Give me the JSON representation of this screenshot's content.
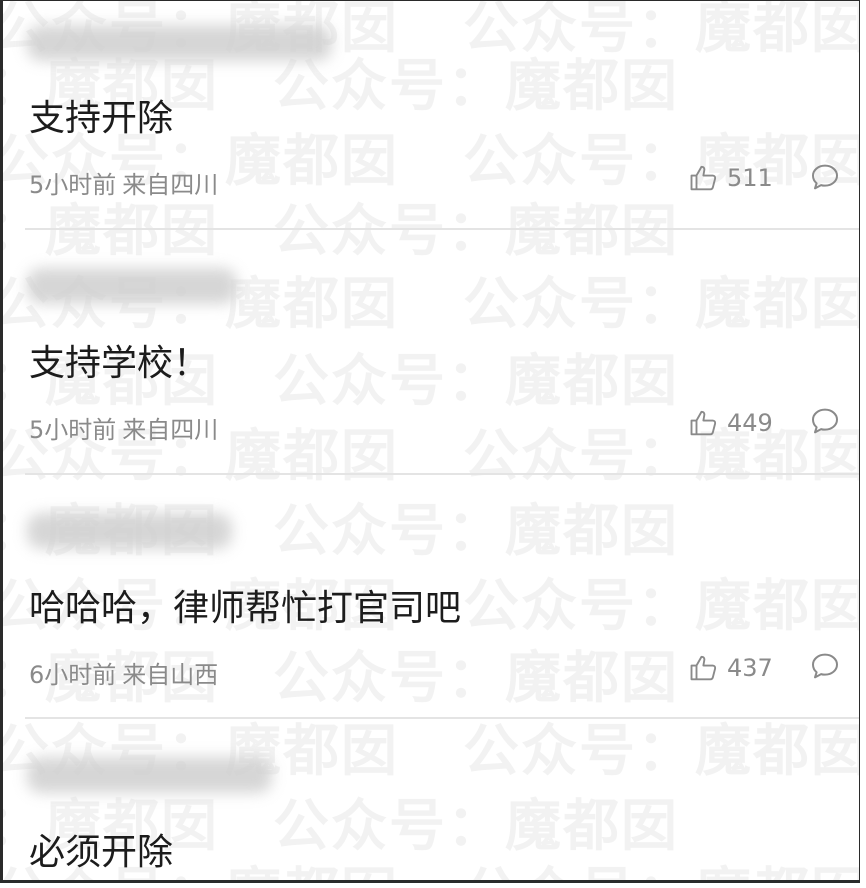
{
  "watermark": {
    "text": "公众号：魔都囡"
  },
  "comments": [
    {
      "content": "支持开除",
      "time": "5小时前",
      "location": "来自四川",
      "likes": "511"
    },
    {
      "content": "支持学校！",
      "time": "5小时前",
      "location": "来自四川",
      "likes": "449"
    },
    {
      "content": "哈哈哈，律师帮忙打官司吧",
      "time": "6小时前",
      "location": "来自山西",
      "likes": "437"
    },
    {
      "content": "必须开除"
    }
  ],
  "icons": {
    "like": "thumbs-up-icon",
    "reply": "comment-bubble-icon"
  },
  "colors": {
    "text": "#1c1c1c",
    "meta": "#8a8a8a",
    "divider": "#e4e4e4"
  }
}
